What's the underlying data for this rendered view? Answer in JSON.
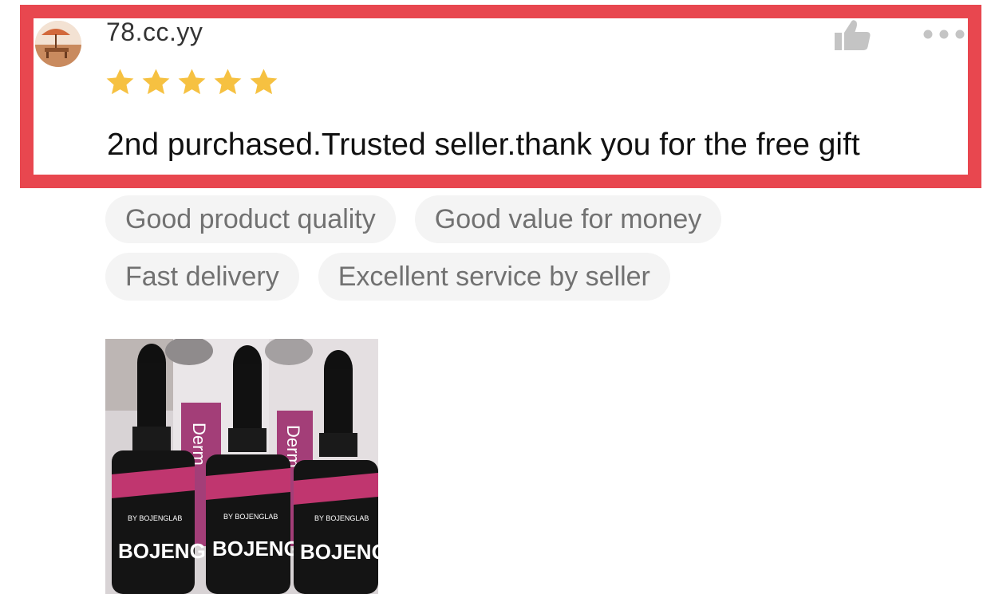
{
  "review": {
    "username": "78.cc.yy",
    "rating": 5,
    "max_rating": 5,
    "text": "2nd purchased.Trusted seller.thank you for the free gift"
  },
  "tags": [
    [
      "Good product quality",
      "Good value for money"
    ],
    [
      "Fast delivery",
      "Excellent service by seller"
    ]
  ],
  "photo": {
    "bottle_brand_small": "BY BOJENGLAB",
    "bottle_brand_large": "BOJENG",
    "box_text": "Derm"
  },
  "colors": {
    "highlight": "#e8474f",
    "star": "#f6c141",
    "tag_bg": "#f4f4f4",
    "tag_text": "#717171",
    "icon_gray": "#c4c4c4"
  },
  "icons": {
    "like": "thumbs-up-icon",
    "more": "more-options-icon",
    "star": "star-icon"
  }
}
